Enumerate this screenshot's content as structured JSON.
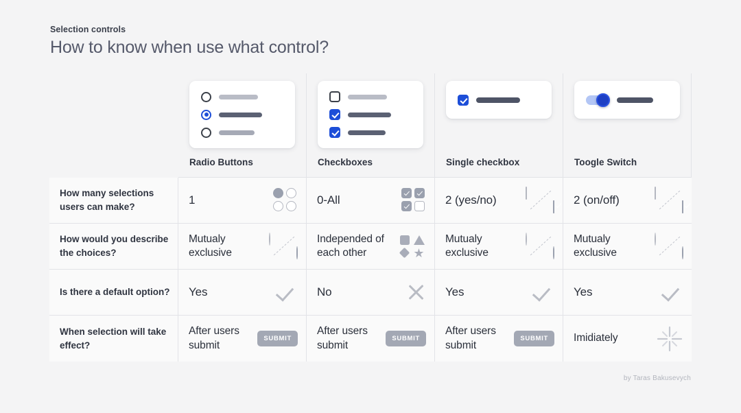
{
  "header": {
    "eyebrow": "Selection controls",
    "title": "How to know when use what control?"
  },
  "colors": {
    "page_bg": "#f4f4f5",
    "cell_bg": "#fafafa",
    "border": "#e2e3e7",
    "accent_blue": "#1d4ed8",
    "text_dark": "#2f3440",
    "text_muted": "#55596a",
    "icon_gray": "#a9adb9",
    "submit_gray": "#a3a8b4"
  },
  "columns": [
    {
      "key": "question",
      "label": ""
    },
    {
      "key": "radio",
      "label": "Radio Buttons"
    },
    {
      "key": "checkbox",
      "label": "Checkboxes"
    },
    {
      "key": "single",
      "label": "Single checkbox"
    },
    {
      "key": "toggle",
      "label": "Toogle Switch"
    }
  ],
  "rows": [
    {
      "question": "How many selections users can make?",
      "cells": [
        {
          "text": "1",
          "icon": "radio-grid-icon"
        },
        {
          "text": "0-All",
          "icon": "checkbox-grid-icon"
        },
        {
          "text": "2 (yes/no)",
          "icon": "checkbox-pair-diagonal-icon"
        },
        {
          "text": "2 (on/off)",
          "icon": "checkbox-pair-diagonal-icon"
        }
      ]
    },
    {
      "question": "How would you describe the choices?",
      "cells": [
        {
          "text": "Mutualy exclusive",
          "icon": "radio-pair-diagonal-icon"
        },
        {
          "text": "Independed of each other",
          "icon": "shapes-icon"
        },
        {
          "text": "Mutualy exclusive",
          "icon": "radio-pair-diagonal-icon"
        },
        {
          "text": "Mutualy exclusive",
          "icon": "radio-pair-diagonal-icon"
        }
      ]
    },
    {
      "question": "Is there a default option?",
      "cells": [
        {
          "text": "Yes",
          "icon": "check-icon"
        },
        {
          "text": "No",
          "icon": "close-icon"
        },
        {
          "text": "Yes",
          "icon": "check-icon"
        },
        {
          "text": "Yes",
          "icon": "check-icon"
        }
      ]
    },
    {
      "question": "When selection will take effect?",
      "cells": [
        {
          "text": "After users submit",
          "icon": "submit-button",
          "button_label": "SUBMIT"
        },
        {
          "text": "After users submit",
          "icon": "submit-button",
          "button_label": "SUBMIT"
        },
        {
          "text": "After users submit",
          "icon": "submit-button",
          "button_label": "SUBMIT"
        },
        {
          "text": "Imidiately",
          "icon": "burst-icon"
        }
      ]
    }
  ],
  "credit": "by Taras Bakusevych"
}
